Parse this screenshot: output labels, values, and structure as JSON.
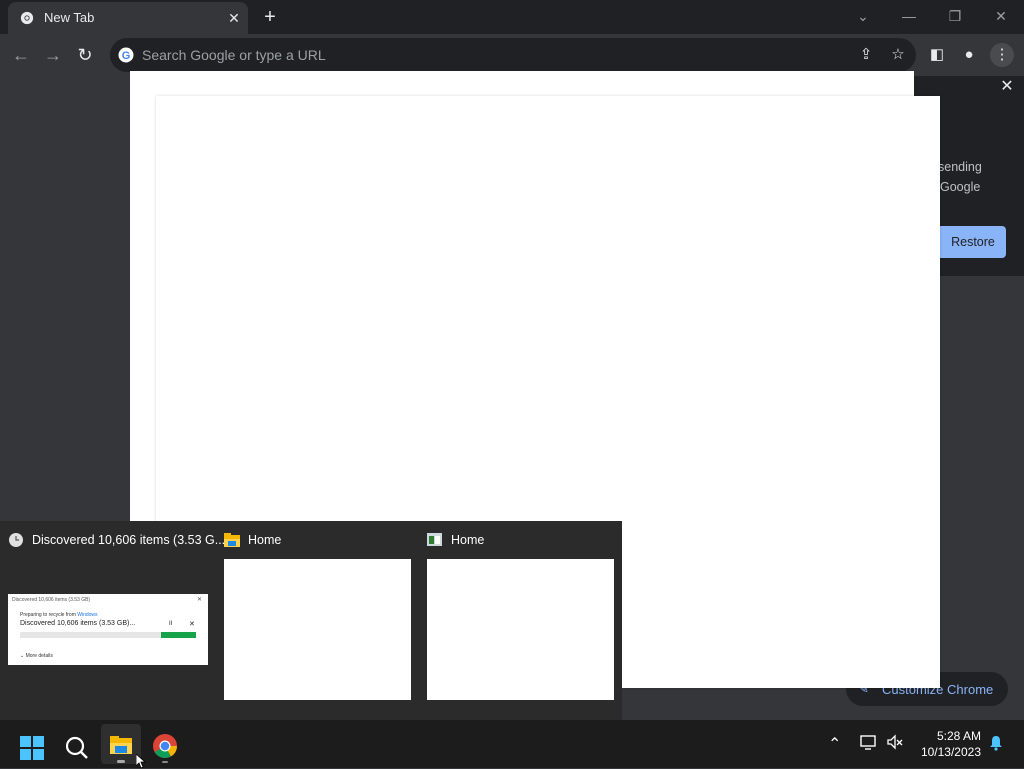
{
  "browser": {
    "tab": {
      "title": "New Tab",
      "favicon": "chrome-icon",
      "close_icon": "close-icon"
    },
    "new_tab_icon": "plus-icon",
    "window_controls": [
      "chevron-down-icon",
      "minimize-icon",
      "restore-icon",
      "close-icon"
    ],
    "toolbar": {
      "back_icon": "arrow-left-icon",
      "forward_icon": "arrow-right-icon",
      "reload_icon": "reload-icon",
      "omnibox_placeholder": "Search Google or type a URL",
      "right_icons": [
        "share-icon",
        "star-icon",
        "side-panel-icon",
        "profile-icon",
        "menu-icon"
      ]
    }
  },
  "side_panel": {
    "text_line1": "sending",
    "text_line2": "Google",
    "restore_label": "Restore",
    "close_icon": "close-icon"
  },
  "customize_chrome": {
    "label": "Customize Chrome",
    "icon": "pencil-icon"
  },
  "thumbnails": [
    {
      "title": "Discovered 10,606 items (3.53 G...",
      "icon": "clock-icon",
      "preview": {
        "header": "Discovered 10,606 items (3.53 GB)",
        "line1_prefix": "Preparing to recycle from",
        "line1_link": "Windows",
        "line2": "Discovered 10,606 items (3.53 GB)...",
        "more": "More details",
        "progress": 0.2
      }
    },
    {
      "title": "Home",
      "icon": "folder-icon"
    },
    {
      "title": "Home",
      "icon": "window-icon"
    }
  ],
  "taskbar": {
    "apps": [
      "windows-start-icon",
      "search-icon",
      "file-explorer-icon",
      "chrome-icon"
    ],
    "time": "5:28 AM",
    "date": "10/13/2023",
    "tray_icons": [
      "chevron-up-icon",
      "network-icon",
      "volume-muted-icon",
      "notification-bell-icon"
    ]
  },
  "colors": {
    "accent": "#8ab4f8",
    "progress_green": "#16a34a",
    "taskbar": "#1c1c1c",
    "chrome_frame": "#202124"
  }
}
